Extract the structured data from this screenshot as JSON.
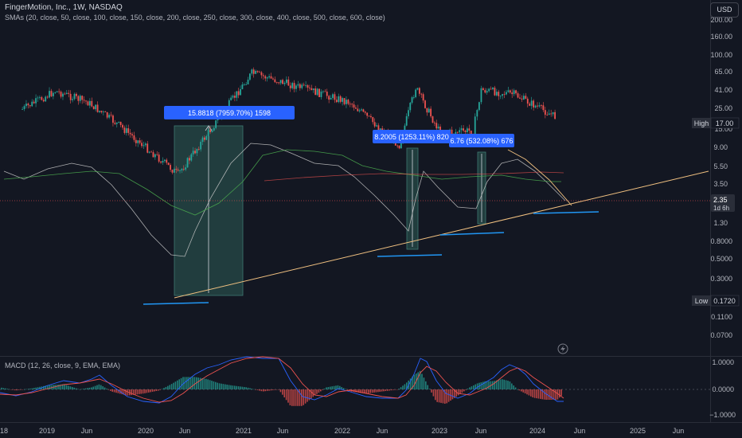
{
  "header": {
    "title": "FingerMotion, Inc., 1W, NASDAQ",
    "sma_legend": "SMAs (20, close, 50, close, 100, close, 150, close, 200, close, 250, close, 300, close, 400, close, 500, close, 600, close)",
    "macd_legend": "MACD (12, 26, close, 9, EMA, EMA)",
    "currency": "USD"
  },
  "price_axis": [
    "200.00",
    "160.00",
    "100.00",
    "65.00",
    "41.00",
    "25.00",
    "15.00",
    "9.00",
    "5.50",
    "3.50",
    "1.30",
    "0.8000",
    "0.5000",
    "0.3000",
    "0.1100",
    "0.0700"
  ],
  "price_tags": {
    "high_label": "High",
    "high_value": "17.00",
    "last_price": "2.35",
    "countdown": "1d 6h",
    "low_label": "Low",
    "low_value": "0.1720"
  },
  "macd_axis": [
    "1.0000",
    "0.0000",
    "−1.0000"
  ],
  "time_axis": [
    "18",
    "2019",
    "Jun",
    "2020",
    "Jun",
    "2021",
    "Jun",
    "2022",
    "Jun",
    "2023",
    "Jun",
    "2024",
    "Jun",
    "2025",
    "Jun"
  ],
  "annotations": [
    "15.8818 (7959.70%) 1598",
    "8.2005 (1253.11%) 820",
    "6.76 (532.08%) 676"
  ],
  "colors": {
    "background": "#131722",
    "up": "#26a69a",
    "down": "#ef5350",
    "trendline": "#f0c080",
    "support": "#2196f3",
    "measure_fill": "#2e5c56",
    "label_bg": "#2962ff"
  },
  "chart_data": {
    "type": "candlestick",
    "instrument": "FingerMotion, Inc.",
    "interval": "1W",
    "exchange": "NASDAQ",
    "price_scale": "log",
    "high": 17.0,
    "low": 0.172,
    "last": 2.35,
    "swing_points": [
      {
        "date": "2018-10",
        "price": 3.3
      },
      {
        "date": "2019-02",
        "price": 7.5
      },
      {
        "date": "2019-06",
        "price": 4.5
      },
      {
        "date": "2019-10",
        "price": 1.5
      },
      {
        "date": "2020-05",
        "price": 0.172
      },
      {
        "date": "2021-02",
        "price": 17.0
      },
      {
        "date": "2022-02",
        "price": 4.5
      },
      {
        "date": "2022-08",
        "price": 0.65
      },
      {
        "date": "2022-10",
        "price": 8.8
      },
      {
        "date": "2023-01",
        "price": 1.1
      },
      {
        "date": "2023-05",
        "price": 1.25
      },
      {
        "date": "2023-06",
        "price": 7.9
      },
      {
        "date": "2023-10",
        "price": 6.5
      },
      {
        "date": "2024-03",
        "price": 2.35
      }
    ]
  }
}
